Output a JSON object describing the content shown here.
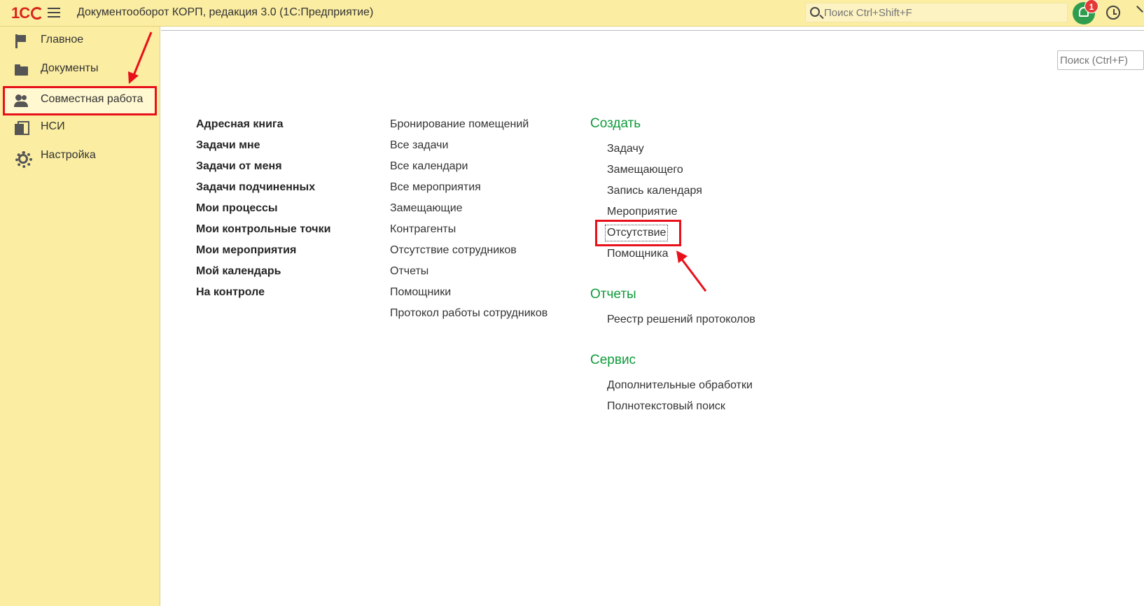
{
  "header": {
    "logo_text": "1С",
    "app_title": "Документооборот КОРП, редакция 3.0  (1С:Предприятие)",
    "search_placeholder": "Поиск Ctrl+Shift+F",
    "notifications_count": "1"
  },
  "sidebar": {
    "items": [
      {
        "label": "Главное",
        "icon": "flag-icon"
      },
      {
        "label": "Документы",
        "icon": "folder-icon"
      },
      {
        "label": "Совместная работа",
        "icon": "people-icon",
        "active": true
      },
      {
        "label": "НСИ",
        "icon": "pages-icon"
      },
      {
        "label": "Настройка",
        "icon": "gear-icon"
      }
    ]
  },
  "main": {
    "search_placeholder": "Поиск (Ctrl+F)",
    "column1": [
      "Адресная книга",
      "Задачи мне",
      "Задачи от меня",
      "Задачи подчиненных",
      "Мои процессы",
      "Мои контрольные точки",
      "Мои мероприятия",
      "Мой календарь",
      "На контроле"
    ],
    "column2": [
      "Бронирование помещений",
      "Все задачи",
      "Все календари",
      "Все мероприятия",
      "Замещающие",
      "Контрагенты",
      "Отсутствие сотрудников",
      "Отчеты",
      "Помощники",
      "Протокол работы сотрудников"
    ],
    "create": {
      "title": "Создать",
      "items": [
        "Задачу",
        "Замещающего",
        "Запись календаря",
        "Мероприятие",
        "Отсутствие",
        "Помощника"
      ]
    },
    "reports": {
      "title": "Отчеты",
      "items": [
        "Реестр решений протоколов"
      ]
    },
    "service": {
      "title": "Сервис",
      "items": [
        "Дополнительные обработки",
        "Полнотекстовый поиск"
      ]
    }
  },
  "colors": {
    "panel_bg": "#fbeda2",
    "section_title": "#0e9b3a",
    "annotation_red": "#e8101a"
  }
}
